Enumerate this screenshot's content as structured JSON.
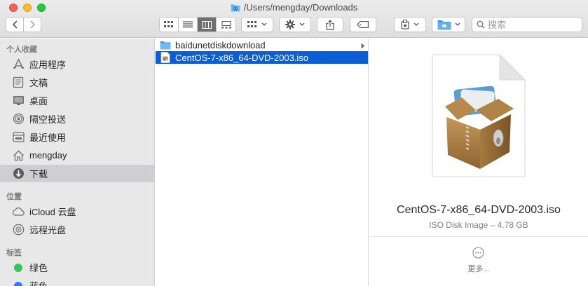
{
  "window": {
    "path": "/Users/mengday/Downloads"
  },
  "toolbar": {
    "view_modes": [
      "icon-view",
      "list-view",
      "column-view",
      "gallery-view"
    ],
    "active_view": "column-view",
    "search_placeholder": "搜索"
  },
  "sidebar": {
    "sections": [
      {
        "title": "个人收藏",
        "items": [
          {
            "label": "应用程序",
            "icon": "applications-icon"
          },
          {
            "label": "文稿",
            "icon": "documents-icon"
          },
          {
            "label": "桌面",
            "icon": "desktop-icon"
          },
          {
            "label": "隔空投送",
            "icon": "airdrop-icon"
          },
          {
            "label": "最近使用",
            "icon": "recents-icon"
          },
          {
            "label": "mengday",
            "icon": "home-icon"
          },
          {
            "label": "下载",
            "icon": "downloads-icon",
            "selected": true
          }
        ]
      },
      {
        "title": "位置",
        "items": [
          {
            "label": "iCloud 云盘",
            "icon": "icloud-icon"
          },
          {
            "label": "远程光盘",
            "icon": "remote-disc-icon"
          }
        ]
      },
      {
        "title": "标签",
        "items": [
          {
            "label": "绿色",
            "color": "#34c759"
          },
          {
            "label": "蓝色",
            "color": "#2f7cf6"
          }
        ]
      }
    ]
  },
  "files": [
    {
      "name": "baidunetdiskdownload",
      "type": "folder"
    },
    {
      "name": "CentOS-7-x86_64-DVD-2003.iso",
      "type": "iso",
      "selected": true
    }
  ],
  "preview": {
    "name": "CentOS-7-x86_64-DVD-2003.iso",
    "meta": "ISO Disk Image – 4.78 GB",
    "more": "更多..."
  },
  "colors": {
    "selection": "#0b5fd5",
    "folder": "#5eb3f0"
  }
}
